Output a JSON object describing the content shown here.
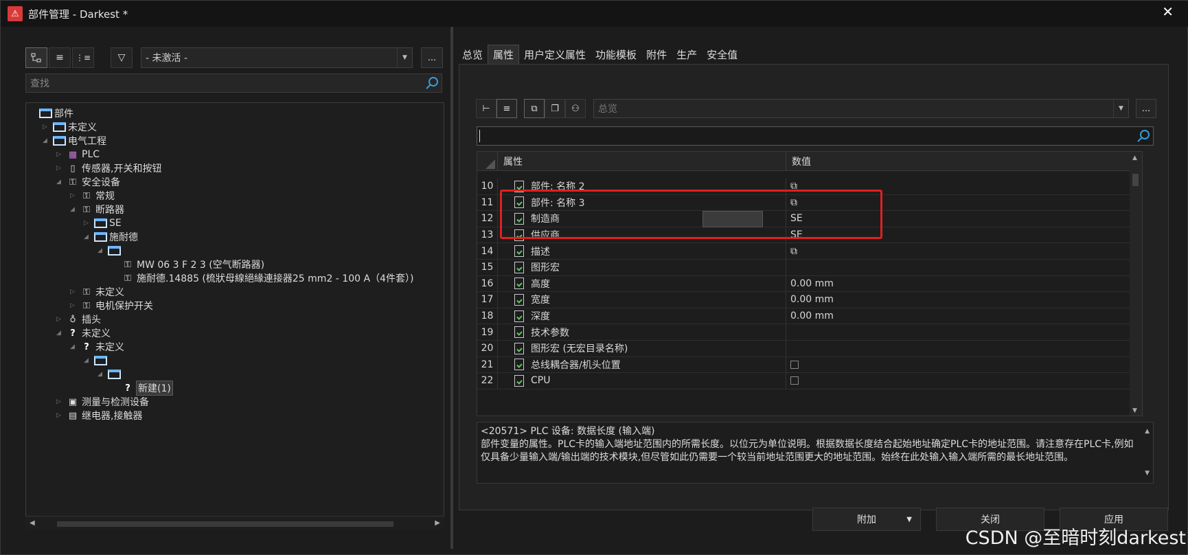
{
  "window": {
    "title": "部件管理 - Darkest *",
    "logo": "app-logo"
  },
  "left": {
    "toolbar": {
      "view1": "tree-view-icon",
      "view2": "list-view-icon",
      "view3": "hierarchy-icon",
      "filter": "filter-icon"
    },
    "filter_value": "- 未激活 -",
    "more": "...",
    "search_placeholder": "查找",
    "tree": [
      {
        "label": "部件",
        "icon": "folder",
        "depth": 0,
        "toggle": ""
      },
      {
        "label": "未定义",
        "icon": "folder",
        "depth": 1,
        "toggle": "▷"
      },
      {
        "label": "电气工程",
        "icon": "folder",
        "depth": 1,
        "toggle": "◢"
      },
      {
        "label": "PLC",
        "icon": "plc",
        "depth": 2,
        "toggle": "▷"
      },
      {
        "label": "传感器,开关和按钮",
        "icon": "sensor",
        "depth": 2,
        "toggle": "▷"
      },
      {
        "label": "安全设备",
        "icon": "safety",
        "depth": 2,
        "toggle": "◢"
      },
      {
        "label": "常规",
        "icon": "safety",
        "depth": 3,
        "toggle": "▷"
      },
      {
        "label": "断路器",
        "icon": "safety",
        "depth": 3,
        "toggle": "◢"
      },
      {
        "label": "SE",
        "icon": "folder",
        "depth": 4,
        "toggle": "▷"
      },
      {
        "label": "施耐德",
        "icon": "folder",
        "depth": 4,
        "toggle": "◢"
      },
      {
        "label": "",
        "icon": "folder",
        "depth": 5,
        "toggle": "◢"
      },
      {
        "label": "MW 06 3 F 2 3 (空气断路器)",
        "icon": "safety",
        "depth": 6,
        "toggle": ""
      },
      {
        "label": "施耐德.14885 (梳狀母線絕緣連接器25 mm2 - 100 A（4件套）)",
        "icon": "safety",
        "depth": 6,
        "toggle": ""
      },
      {
        "label": "未定义",
        "icon": "safety",
        "depth": 3,
        "toggle": "▷"
      },
      {
        "label": "电机保护开关",
        "icon": "safety",
        "depth": 3,
        "toggle": "▷"
      },
      {
        "label": "插头",
        "icon": "plug",
        "depth": 2,
        "toggle": "▷"
      },
      {
        "label": "未定义",
        "icon": "question",
        "depth": 2,
        "toggle": "◢"
      },
      {
        "label": "未定义",
        "icon": "question",
        "depth": 3,
        "toggle": "◢"
      },
      {
        "label": "",
        "icon": "folder",
        "depth": 4,
        "toggle": "◢"
      },
      {
        "label": "",
        "icon": "folder",
        "depth": 5,
        "toggle": "◢"
      },
      {
        "label": "新建(1)",
        "icon": "question",
        "depth": 6,
        "toggle": "",
        "selected": true
      },
      {
        "label": "测量与检测设备",
        "icon": "meter",
        "depth": 2,
        "toggle": "▷"
      },
      {
        "label": "继电器,接触器",
        "icon": "relay",
        "depth": 2,
        "toggle": "▷"
      }
    ]
  },
  "right": {
    "tabs": [
      "总览",
      "属性",
      "用户定义属性",
      "功能模板",
      "附件",
      "生产",
      "安全值"
    ],
    "active_tab": 1,
    "view_combo": "总览",
    "more": "...",
    "grid": {
      "col_property": "属性",
      "col_value": "数值",
      "rows": [
        {
          "n": "10",
          "p": "部件: 名称 2",
          "v": "",
          "vicon": true
        },
        {
          "n": "11",
          "p": "部件: 名称 3",
          "v": "",
          "vicon": true
        },
        {
          "n": "12",
          "p": "制造商",
          "v": "SE"
        },
        {
          "n": "13",
          "p": "供应商",
          "v": "SE"
        },
        {
          "n": "14",
          "p": "描述",
          "v": "",
          "vicon": true
        },
        {
          "n": "15",
          "p": "图形宏",
          "v": ""
        },
        {
          "n": "16",
          "p": "高度",
          "v": "0.00 mm"
        },
        {
          "n": "17",
          "p": "宽度",
          "v": "0.00 mm"
        },
        {
          "n": "18",
          "p": "深度",
          "v": "0.00 mm"
        },
        {
          "n": "19",
          "p": "技术参数",
          "v": ""
        },
        {
          "n": "20",
          "p": "图形宏 (无宏目录名称)",
          "v": ""
        },
        {
          "n": "21",
          "p": "总线耦合器/机头位置",
          "v": "",
          "check": true
        },
        {
          "n": "22",
          "p": "CPU",
          "v": "",
          "check": true
        }
      ]
    },
    "description": "<20571> PLC 设备: 数据长度 (输入端)\n部件变量的属性。PLC卡的输入端地址范围内的所需长度。以位元为单位说明。根据数据长度结合起始地址确定PLC卡的地址范围。请注意存在PLC卡,例如仅具备少量输入端/输出端的技术模块,但尽管如此仍需要一个较当前地址范围更大的地址范围。始终在此处输入输入端所需的最长地址范围。",
    "buttons": {
      "add": "附加",
      "close": "关闭",
      "apply": "应用"
    }
  },
  "watermark": "CSDN @至暗时刻darkest"
}
